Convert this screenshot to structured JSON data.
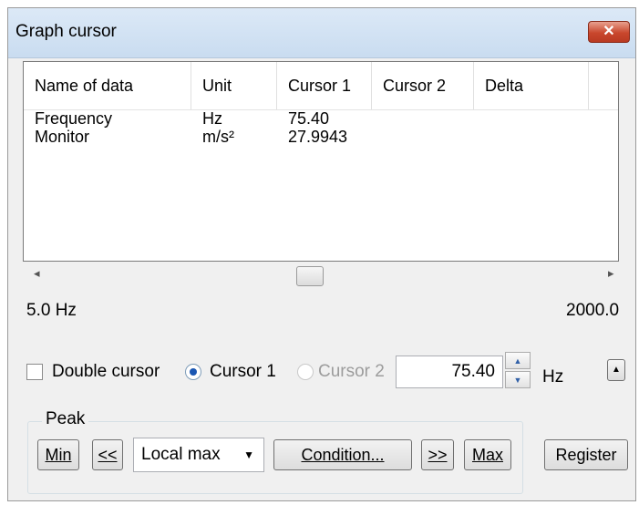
{
  "window": {
    "title": "Graph cursor",
    "close_glyph": "✕"
  },
  "table": {
    "columns": [
      "Name of data",
      "Unit",
      "Cursor 1",
      "Cursor 2",
      "Delta"
    ],
    "rows": [
      [
        "Frequency",
        "Hz",
        "75.40",
        "",
        ""
      ],
      [
        "Monitor",
        "m/s²",
        "27.9943",
        "",
        ""
      ]
    ]
  },
  "scroll": {
    "left_arrow": "◂",
    "right_arrow": "▸"
  },
  "range": {
    "min_label": "5.0  Hz",
    "max_label": "2000.0"
  },
  "controls": {
    "double_cursor_label": "Double cursor",
    "double_cursor_checked": false,
    "cursor1_label": "Cursor 1",
    "cursor2_label": "Cursor 2",
    "selected_cursor": "Cursor 1",
    "value": "75.40",
    "unit": "Hz",
    "spin_up": "▲",
    "spin_down": "▼",
    "toggle_glyph": "▲"
  },
  "peak": {
    "group_label": "Peak",
    "min_label": "Min",
    "prev_label": "<<",
    "mode_value": "Local max",
    "dropdown_arrow": "▼",
    "condition_label": "Condition...",
    "next_label": ">>",
    "max_label": "Max"
  },
  "register_label": "Register"
}
